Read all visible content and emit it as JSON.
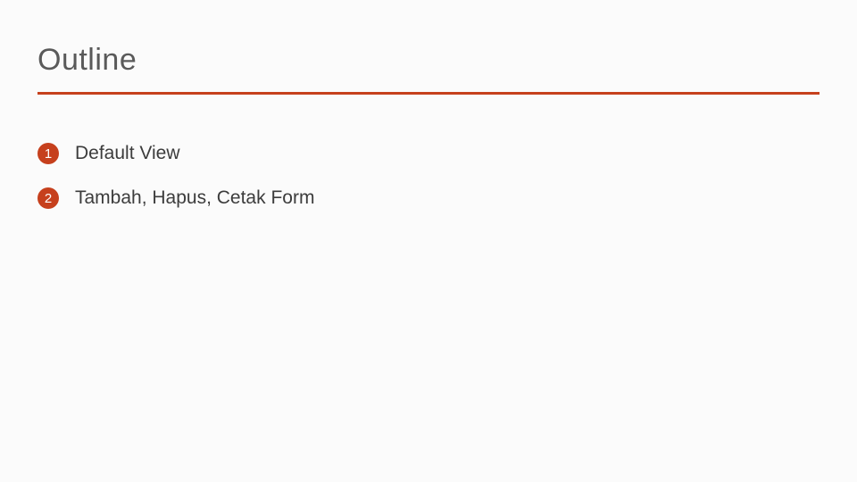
{
  "title": "Outline",
  "accent_color": "#c6401d",
  "items": [
    {
      "number": "1",
      "label": "Default View"
    },
    {
      "number": "2",
      "label": "Tambah, Hapus, Cetak Form"
    }
  ]
}
